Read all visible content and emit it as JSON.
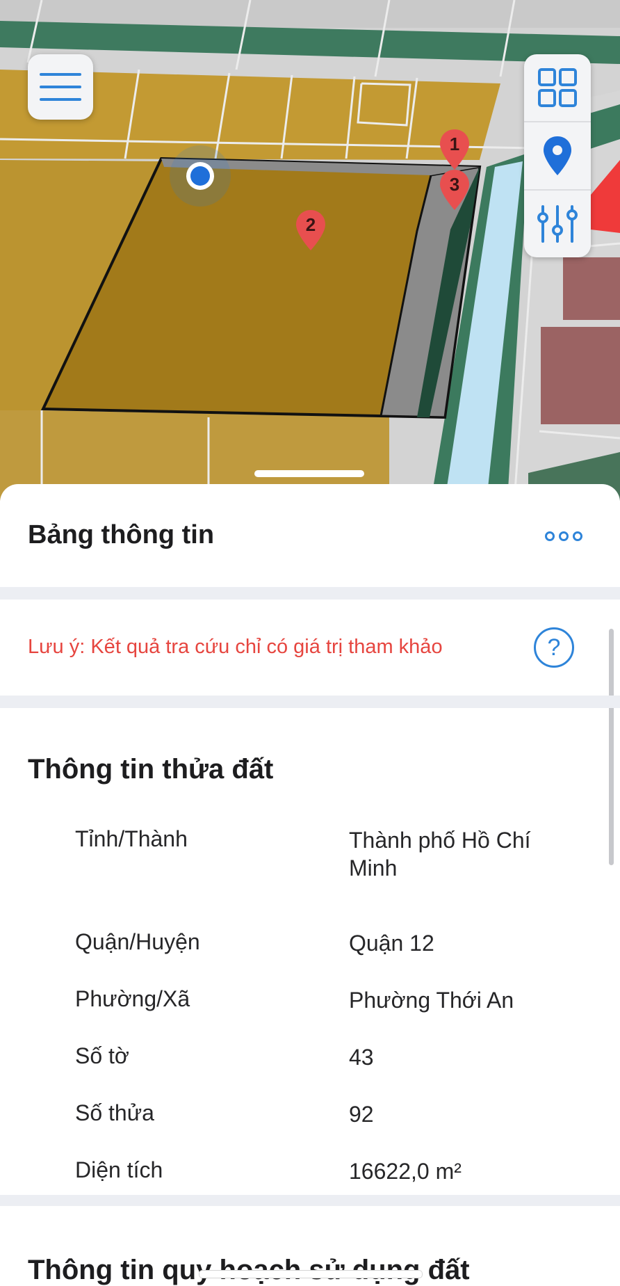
{
  "map": {
    "markers": [
      {
        "label": "1"
      },
      {
        "label": "2"
      },
      {
        "label": "3"
      }
    ],
    "icons": {
      "menu": "menu-icon",
      "grid": "grid-icon",
      "location": "location-pin-icon",
      "filter": "sliders-icon"
    }
  },
  "panel": {
    "title": "Bảng thông tin",
    "note": "Lưu ý: Kết quả tra cứu chỉ có giá trị tham khảo",
    "help_glyph": "?"
  },
  "parcel": {
    "title": "Thông tin thửa đất",
    "rows": [
      {
        "label": "Tỉnh/Thành",
        "value": "Thành phố Hồ Chí Minh"
      },
      {
        "label": "Quận/Huyện",
        "value": "Quận 12"
      },
      {
        "label": "Phường/Xã",
        "value": "Phường Thới An"
      },
      {
        "label": "Số tờ",
        "value": "43"
      },
      {
        "label": "Số thửa",
        "value": "92"
      },
      {
        "label": "Diện tích",
        "value": "16622,0 m²"
      }
    ]
  },
  "planning": {
    "title": "Thông tin quy hoạch sử dụng đất"
  },
  "colors": {
    "accent": "#2e84d9",
    "warning": "#e6453f",
    "parcel_fill": "#a27a1a",
    "road_green": "#3c7a5e",
    "water": "#bcdff2",
    "marker": "#e84f4f"
  }
}
